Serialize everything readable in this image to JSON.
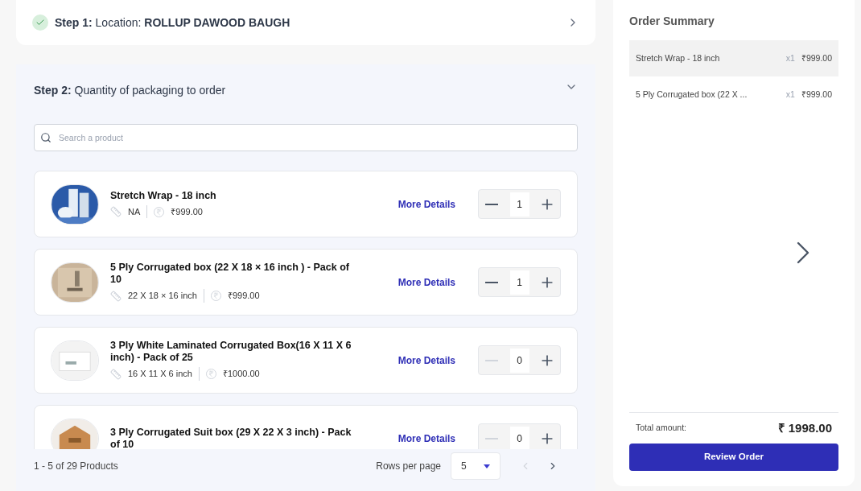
{
  "step1": {
    "label": "Step 1:",
    "text": "Location:",
    "location": "ROLLUP DAWOOD BAUGH",
    "completed": true
  },
  "step2": {
    "label": "Step 2:",
    "text": "Quantity of packaging to order",
    "expanded": true
  },
  "search": {
    "placeholder": "Search a product"
  },
  "products": [
    {
      "name": "Stretch Wrap - 18 inch",
      "size": "NA",
      "price": "₹999.00",
      "link": "More Details",
      "quantity": "1",
      "decrease_disabled": false
    },
    {
      "name": "5 Ply Corrugated box (22 X 18 × 16 inch ) - Pack of 10",
      "size": "22 X 18 × 16 inch",
      "price": "₹999.00",
      "link": "More Details",
      "quantity": "1",
      "decrease_disabled": false
    },
    {
      "name": "3 Ply White Laminated Corrugated Box(16 X 11 X 6 inch) - Pack of 25",
      "size": "16 X 11 X 6 inch",
      "price": "₹1000.00",
      "link": "More Details",
      "quantity": "0",
      "decrease_disabled": true
    },
    {
      "name": "3 Ply Corrugated Suit box (29 X 22 X 3 inch) - Pack of 10",
      "link": "More Details",
      "quantity": "0",
      "decrease_disabled": true
    }
  ],
  "pagination": {
    "range": "1 - 5 of 29 Products",
    "rows_label": "Rows per page",
    "rows_value": "5"
  },
  "summary": {
    "title": "Order Summary",
    "items": [
      {
        "name": "Stretch Wrap - 18 inch",
        "qty": "x1",
        "price": "₹999.00",
        "highlighted": true
      },
      {
        "name": "5 Ply Corrugated box (22 X ...",
        "qty": "x1",
        "price": "₹999.00",
        "highlighted": false
      }
    ],
    "total_label": "Total amount:",
    "total": "₹ 1998.00",
    "button": "Review Order"
  }
}
